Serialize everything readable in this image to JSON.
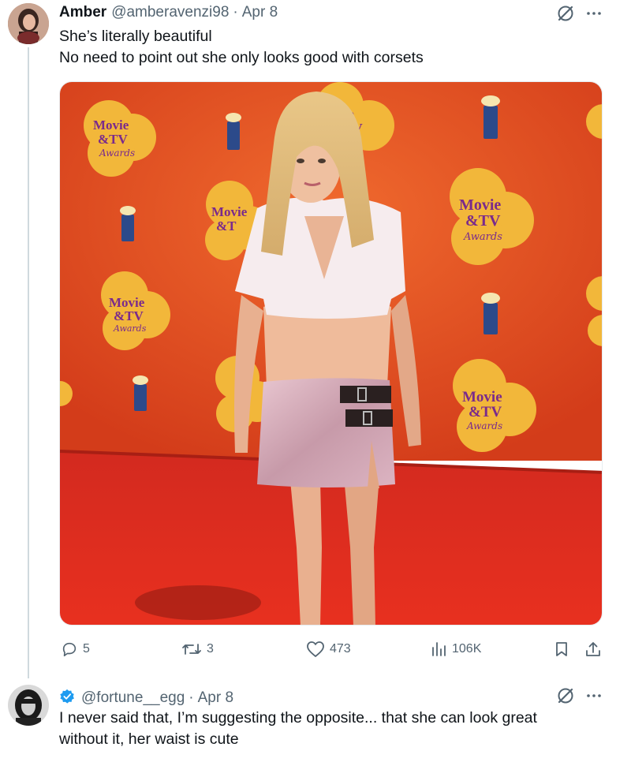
{
  "tweet": {
    "author_name": "Amber",
    "handle": "@amberavenzi98",
    "date": "Apr 8",
    "text_line1": "She’s literally beautiful",
    "text_line2": "No need to point out she only looks good with corsets",
    "media_alt": "",
    "media_logo_lines": [
      "Movie",
      "&TV",
      "Awards"
    ],
    "media_logo_badge": "M",
    "stats": {
      "replies": "5",
      "retweets": "3",
      "likes": "473",
      "views": "106K"
    }
  },
  "reply": {
    "handle": "@fortune__egg",
    "date": "Apr 8",
    "text_line1": "I never said that, I’m suggesting the opposite... that she can look great",
    "text_line2": "without it, her waist is cute"
  },
  "colors": {
    "muted": "#536471",
    "verified": "#1d9bf0",
    "backdrop": "#e24a23",
    "carpet": "#d42a1c",
    "gold": "#f2b73a"
  },
  "icons": {
    "grok": "grok-icon",
    "more": "more-icon",
    "reply": "reply-icon",
    "retweet": "retweet-icon",
    "like": "heart-icon",
    "views": "views-icon",
    "bookmark": "bookmark-icon",
    "share": "share-icon",
    "verified": "verified-badge-icon"
  }
}
